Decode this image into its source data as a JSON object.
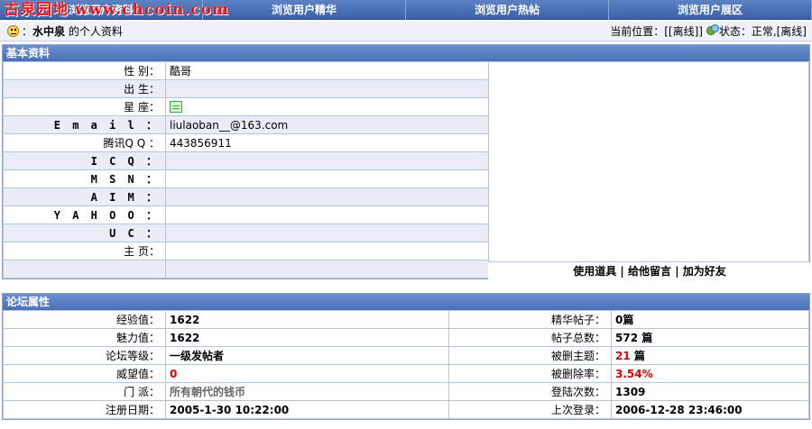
{
  "watermark": "古泉园地 www.chcoin.com",
  "nav": {
    "tabs": [
      "浏览用户资料",
      "浏览用户精华",
      "浏览用户热帖",
      "浏览用户展区"
    ]
  },
  "userbar": {
    "username": "水中泉",
    "suffix": "的个人资料",
    "position_label": "当前位置：[[离线]]",
    "status_label": "状态：正常,[离线]"
  },
  "basic": {
    "title": "基本资料",
    "rows": [
      {
        "label": "性 别：",
        "value": ""
      },
      {
        "label": "出 生：",
        "value": ""
      },
      {
        "label": "星 座：",
        "value": ""
      },
      {
        "label": "E m a i l ：",
        "value": "liulaoban__@163.com"
      },
      {
        "label": "腾讯Q Q ：",
        "value": "443856911"
      },
      {
        "label": "I C Q ：",
        "value": ""
      },
      {
        "label": "M S N ：",
        "value": ""
      },
      {
        "label": "A I M ：",
        "value": ""
      },
      {
        "label": "Y A H O O ：",
        "value": ""
      },
      {
        "label": "U C ：",
        "value": ""
      },
      {
        "label": "主 页：",
        "value": ""
      }
    ],
    "gender": "酷哥",
    "actions": {
      "use_item": "使用道具",
      "leave_msg": "给他留言",
      "add_friend": "加为好友",
      "sep": "|"
    }
  },
  "forum": {
    "title": "论坛属性",
    "left": [
      {
        "label": "经验值：",
        "value": "1622"
      },
      {
        "label": "魅力值：",
        "value": "1622"
      },
      {
        "label": "论坛等级：",
        "value": "一级发帖者"
      },
      {
        "label": "威望值：",
        "value": "0"
      },
      {
        "label": "门 派：",
        "value": "所有朝代的钱币"
      },
      {
        "label": "注册日期：",
        "value": "2005-1-30 10:22:00"
      }
    ],
    "right": [
      {
        "label": "精华帖子：",
        "value": "0篇"
      },
      {
        "label": "帖子总数：",
        "value": "572 篇"
      },
      {
        "label": "被删主题：",
        "value": "21",
        "unit": " 篇"
      },
      {
        "label": "被删除率：",
        "value": "3.54%"
      },
      {
        "label": "登陆次数：",
        "value": "1309"
      },
      {
        "label": "上次登录：",
        "value": "2006-12-28 23:46:00"
      }
    ]
  },
  "colors": {
    "accent": "#4a70b8",
    "red": "#e00000"
  }
}
